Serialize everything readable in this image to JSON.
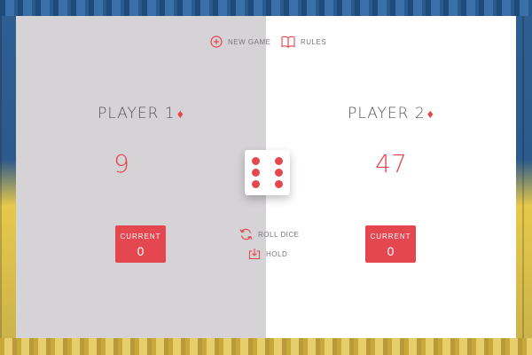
{
  "toolbar": {
    "new_game_label": "NEW GAME",
    "rules_label": "RULES"
  },
  "players": [
    {
      "name": "PLAYER 1",
      "score": "9",
      "current_label": "CURRENT",
      "current_value": "0",
      "active": true
    },
    {
      "name": "PLAYER 2",
      "score": "47",
      "current_label": "CURRENT",
      "current_value": "0",
      "active": true
    }
  ],
  "actions": {
    "roll_label": "ROLL DICE",
    "hold_label": "HOLD"
  },
  "dice": {
    "face": 6
  },
  "colors": {
    "accent": "#e4474f",
    "panel_inactive": "#d6d3d6",
    "panel_active": "#ffffff"
  }
}
